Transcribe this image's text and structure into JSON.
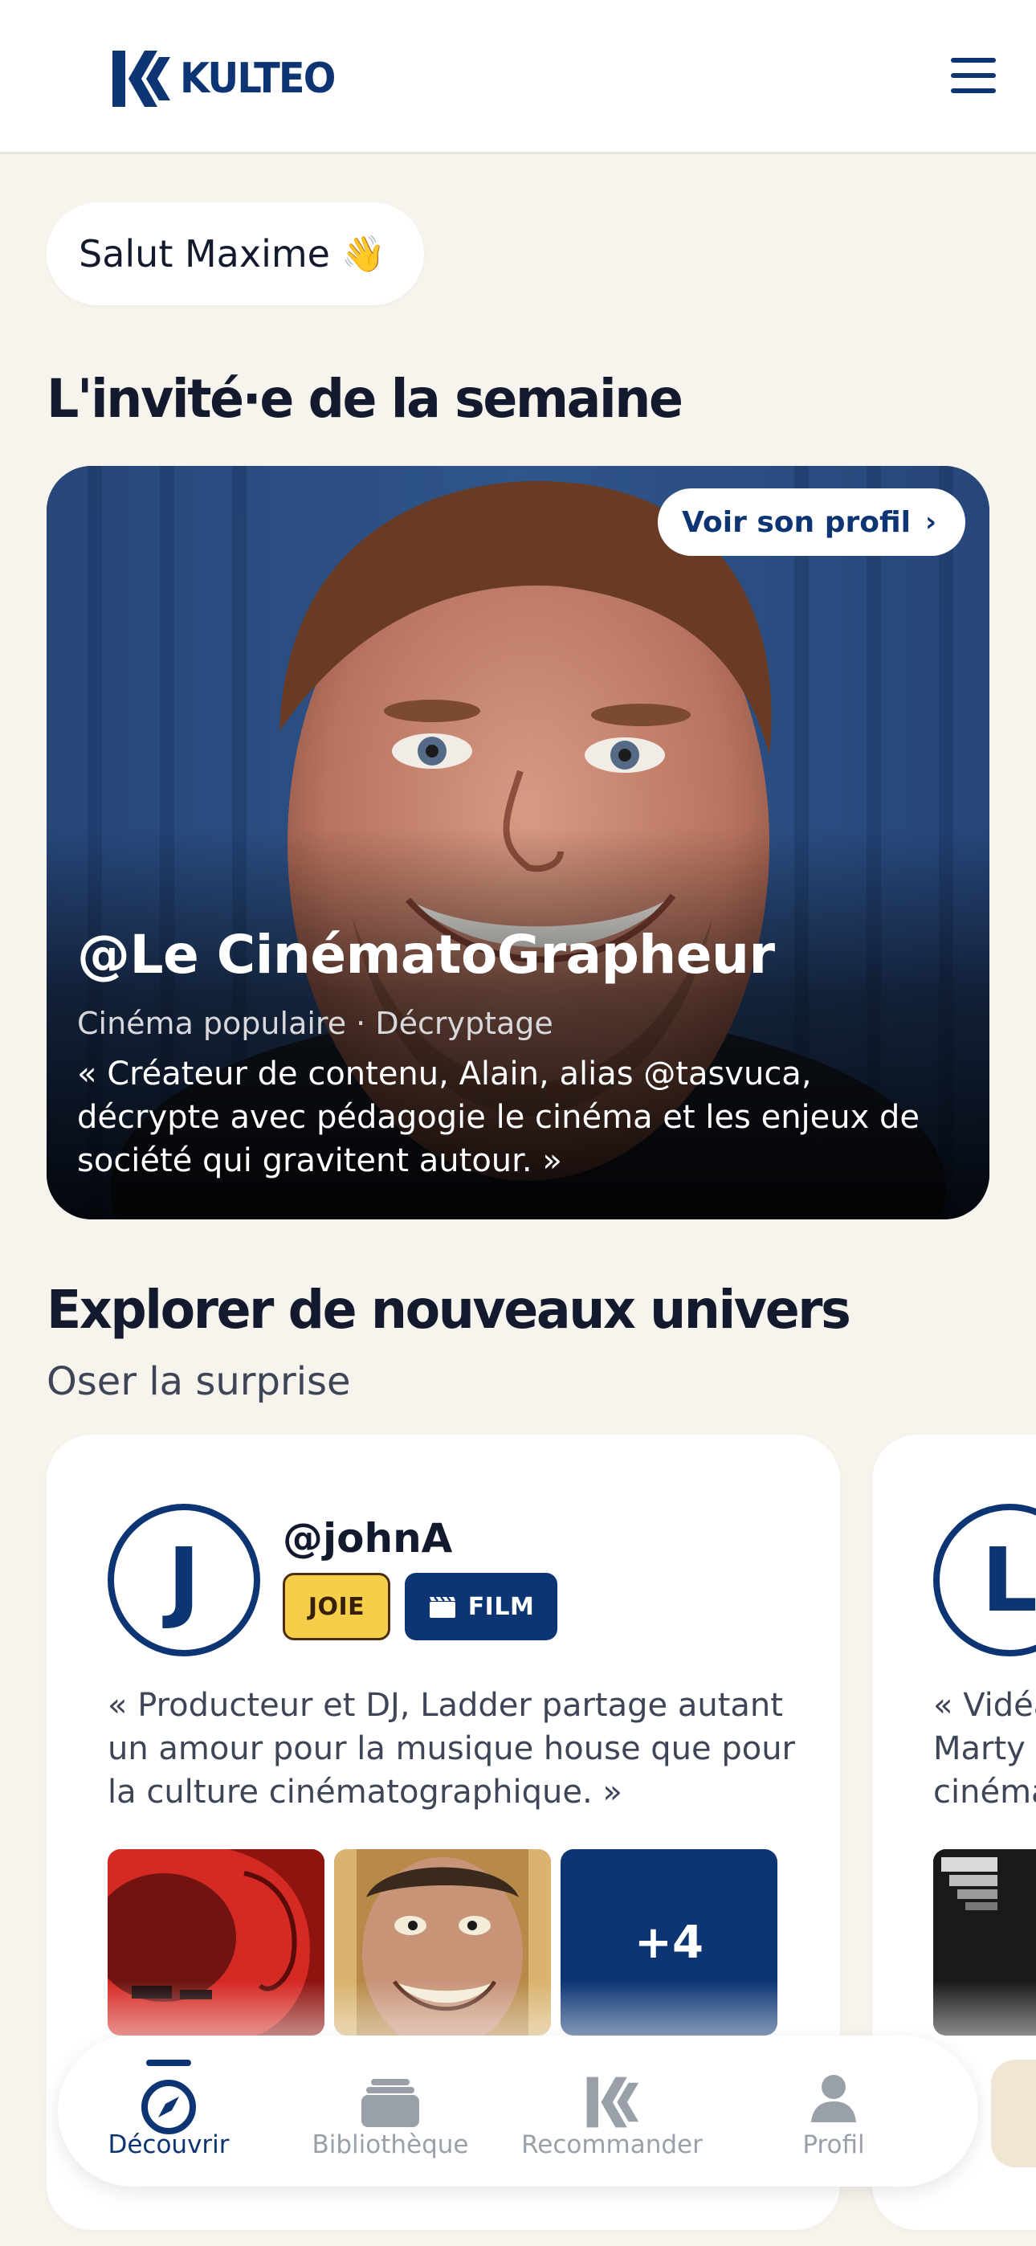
{
  "header": {
    "brand": "KULTEO",
    "menu_icon": "hamburger-menu-icon"
  },
  "greeting": {
    "text": "Salut Maxime",
    "emoji": "👋"
  },
  "guest_section": {
    "title": "L'invité·e de la semaine",
    "profile_button": "Voir son profil",
    "name": "@Le CinématoGrapheur",
    "tags": "Cinéma populaire · Décryptage",
    "quote": "« Créateur de contenu, Alain, alias @tasvuca, décrypte avec pédagogie le cinéma et les enjeux de société qui gravitent autour. »"
  },
  "explore_section": {
    "title": "Explorer de nouveaux univers",
    "subtitle": "Oser la surprise",
    "cards": [
      {
        "avatar_letter": "J",
        "handle": "@johnA",
        "mood_tag": "JOIE",
        "type_tag": "FILM",
        "quote": "« Producteur et DJ, Ladder partage autant un amour pour la musique house que pour la culture cinématographique. »",
        "more_count": "+4"
      },
      {
        "avatar_letter": "L",
        "quote_line1": "« Vidéa",
        "quote_line2": "Marty a",
        "quote_line3": "cinéma"
      }
    ]
  },
  "bottom_nav": {
    "items": [
      {
        "label": "Découvrir",
        "icon": "compass-icon",
        "active": true
      },
      {
        "label": "Bibliothèque",
        "icon": "library-icon",
        "active": false
      },
      {
        "label": "Recommander",
        "icon": "kulteo-mark-icon",
        "active": false
      },
      {
        "label": "Profil",
        "icon": "person-icon",
        "active": false
      }
    ]
  },
  "colors": {
    "brand_navy": "#0d3574",
    "background": "#f7f4ee",
    "joy_yellow": "#f5cf4a"
  }
}
